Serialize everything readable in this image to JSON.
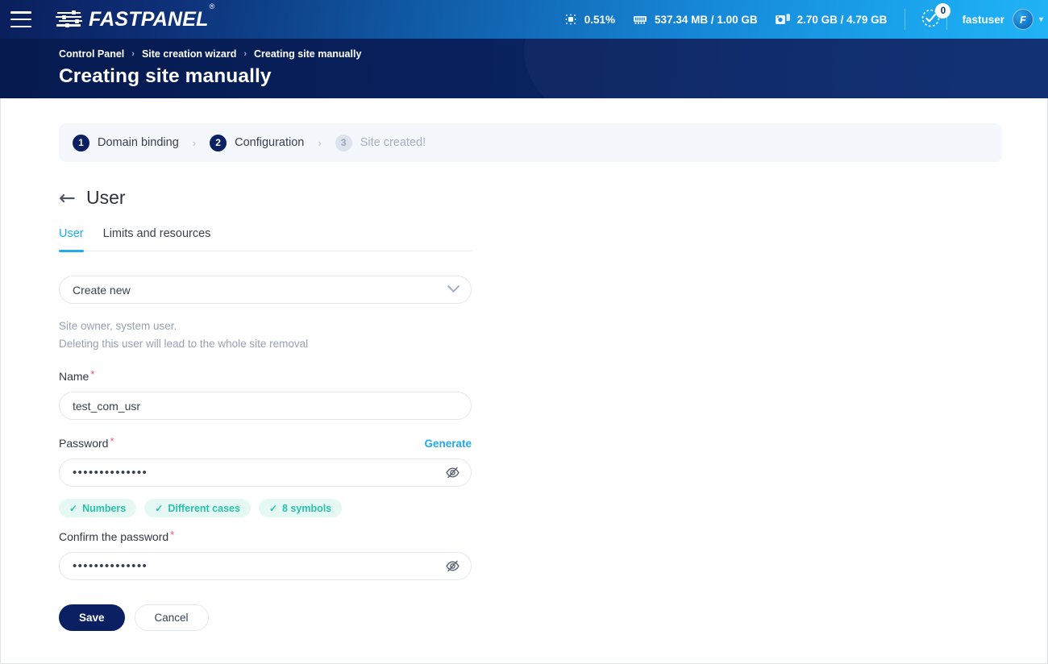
{
  "topbar": {
    "menu_icon": "hamburger-icon",
    "brand": "FASTPANEL",
    "brand_trademark": "®",
    "stats": [
      {
        "icon": "cpu-icon",
        "name": "cpu",
        "value": "0.51%"
      },
      {
        "icon": "ram-icon",
        "name": "ram",
        "value": "537.34 MB / 1.00 GB"
      },
      {
        "icon": "disk-icon",
        "name": "disk",
        "value": "2.70 GB / 4.79 GB"
      }
    ],
    "notifications": {
      "icon": "tasks-check-icon",
      "count": "0"
    },
    "user": {
      "name": "fastuser",
      "avatar_initial": "F",
      "caret": "chevron-down-icon"
    }
  },
  "banner": {
    "breadcrumb": [
      {
        "label": "Control Panel"
      },
      {
        "label": "Site creation wizard"
      },
      {
        "label": "Creating site manually"
      }
    ],
    "separator": "›",
    "title": "Creating site manually"
  },
  "stepper": {
    "steps": [
      {
        "num": "1",
        "label": "Domain binding",
        "state": "done"
      },
      {
        "num": "2",
        "label": "Configuration",
        "state": "active"
      },
      {
        "num": "3",
        "label": "Site created!",
        "state": "inactive"
      }
    ],
    "separator": "›"
  },
  "page": {
    "back_icon": "arrow-left-icon",
    "title": "User",
    "tabs": [
      {
        "label": "User",
        "active": true
      },
      {
        "label": "Limits and resources",
        "active": false
      }
    ]
  },
  "form": {
    "user_mode": {
      "label": "",
      "value": "Create new",
      "chevron": "chevron-down-icon"
    },
    "hint_line1": "Site owner, system user.",
    "hint_line2": "Deleting this user will lead to the whole site removal",
    "name": {
      "label": "Name",
      "required_mark": "*",
      "value": "test_com_usr",
      "placeholder": ""
    },
    "password": {
      "label": "Password",
      "required_mark": "*",
      "generate_label": "Generate",
      "value": "••••••••••••••",
      "placeholder": "",
      "toggle_icon": "eye-off-icon"
    },
    "password_rules": [
      {
        "check": "✓",
        "label": "Numbers"
      },
      {
        "check": "✓",
        "label": "Different cases"
      },
      {
        "check": "✓",
        "label": "8 symbols"
      }
    ],
    "confirm_password": {
      "label": "Confirm the password",
      "required_mark": "*",
      "value": "••••••••••••••",
      "placeholder": "",
      "toggle_icon": "eye-off-icon"
    },
    "save_label": "Save",
    "cancel_label": "Cancel"
  },
  "colors": {
    "brand_dark": "#0b1f63",
    "brand_light": "#1fabf0",
    "accent_green": "#27c3ab",
    "required_red": "#f2566f",
    "banner_dark": "#071c52"
  }
}
